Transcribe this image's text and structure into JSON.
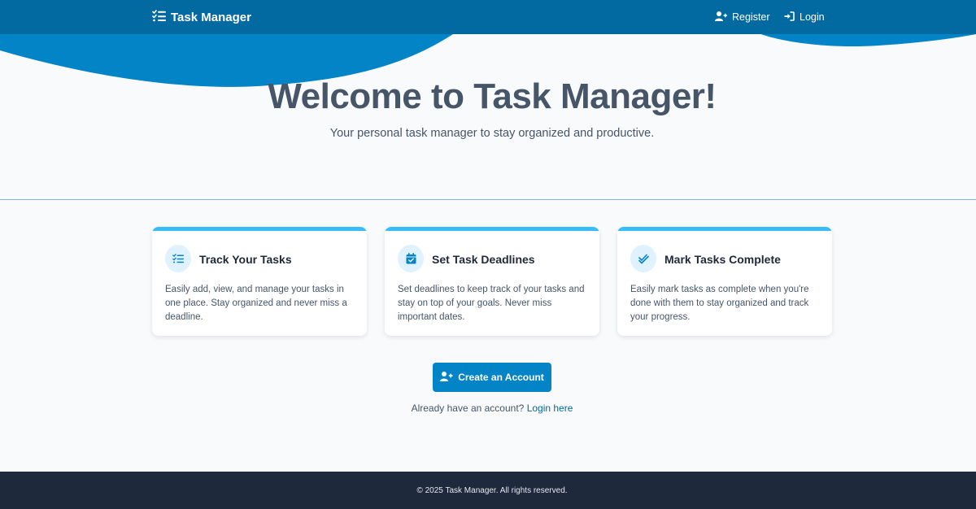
{
  "header": {
    "brand": "Task Manager",
    "register_label": "Register",
    "login_label": "Login"
  },
  "hero": {
    "title": "Welcome to Task Manager!",
    "subtitle": "Your personal task manager to stay organized and productive."
  },
  "features": [
    {
      "icon": "list-check-icon",
      "title": "Track Your Tasks",
      "description": "Easily add, view, and manage your tasks in one place. Stay organized and never miss a deadline."
    },
    {
      "icon": "calendar-check-icon",
      "title": "Set Task Deadlines",
      "description": "Set deadlines to keep track of your tasks and stay on top of your goals. Never miss important dates."
    },
    {
      "icon": "double-check-icon",
      "title": "Mark Tasks Complete",
      "description": "Easily mark tasks as complete when you're done with them to stay organized and track your progress."
    }
  ],
  "cta": {
    "button_label": "Create an Account",
    "prompt_text": "Already have an account?",
    "login_link": "Login here"
  },
  "footer": {
    "text": "© 2025 Task Manager. All rights reserved."
  },
  "colors": {
    "header": "#0369a1",
    "accent": "#0284c7",
    "card_top_border": "#38bdf8",
    "footer": "#1e293b",
    "background": "#f8fafc"
  }
}
